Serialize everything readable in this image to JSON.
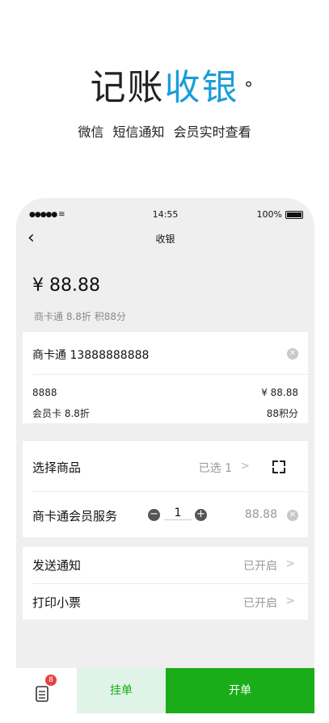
{
  "promo": {
    "title_dark": "记账",
    "title_accent": "收银",
    "title_mark": "°",
    "subtitle": "微信  短信通知  会员实时查看"
  },
  "status_bar": {
    "signal": "●●●●●",
    "time": "14:55",
    "battery": "100%"
  },
  "nav": {
    "back": "‹",
    "title": "收银"
  },
  "payment": {
    "amount": "¥ 88.88",
    "discount_note": "商卡通 8.8折 积88分"
  },
  "member": {
    "name": "商卡通 13888888888",
    "card_no": "8888",
    "card_price": "¥ 88.88",
    "card_type": "会员卡 8.8折",
    "points": "88积分"
  },
  "goods": {
    "select_label": "选择商品",
    "selected_text": "已选 1",
    "service_name": "商卡通会员服务",
    "quantity": "1",
    "service_price": "88.88"
  },
  "settings": {
    "notify_label": "发送通知",
    "notify_status": "已开启",
    "print_label": "打印小票",
    "print_status": "已开启"
  },
  "bottom_bar": {
    "badge_count": "8",
    "hold_label": "挂单",
    "open_label": "开单"
  },
  "colors": {
    "accent_blue": "#1a9dd9",
    "primary_green": "#1aad19",
    "hold_bg": "#dff4e6",
    "badge_red": "#e64340"
  }
}
